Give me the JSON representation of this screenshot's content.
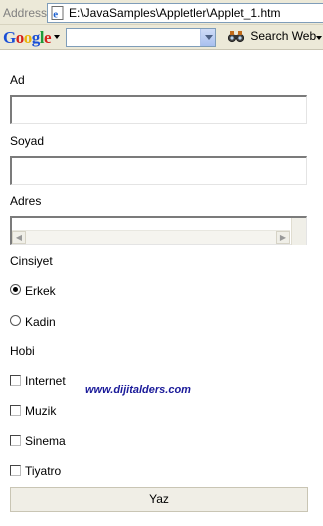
{
  "address_bar": {
    "label": "Address",
    "url": "E:\\JavaSamples\\Appletler\\Applet_1.htm"
  },
  "google_toolbar": {
    "logo": "Google",
    "search_value": "",
    "search_web_label": "Search Web",
    "logo_colors": [
      "#1a4fd6",
      "#d5221d",
      "#e9b40c",
      "#1a4fd6",
      "#1f9a3a",
      "#d5221d"
    ]
  },
  "form": {
    "ad_label": "Ad",
    "ad_value": "",
    "soyad_label": "Soyad",
    "soyad_value": "",
    "adres_label": "Adres",
    "adres_value": "",
    "cinsiyet_label": "Cinsiyet",
    "gender_options": [
      {
        "label": "Erkek",
        "checked": true
      },
      {
        "label": "Kadin",
        "checked": false
      }
    ],
    "hobi_label": "Hobi",
    "hobbies": [
      {
        "label": "Internet",
        "checked": false
      },
      {
        "label": "Muzik",
        "checked": false
      },
      {
        "label": "Sinema",
        "checked": false
      },
      {
        "label": "Tiyatro",
        "checked": false
      }
    ],
    "submit_label": "Yaz"
  },
  "watermark": "www.dijitalders.com"
}
